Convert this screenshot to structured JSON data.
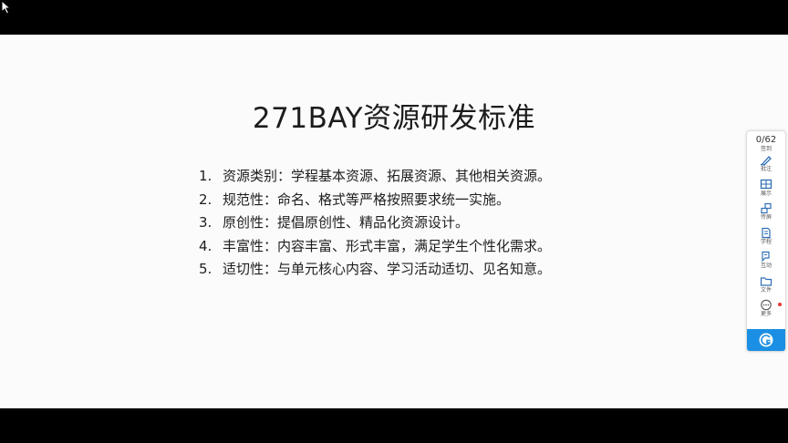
{
  "slide": {
    "title": "271BAY资源研发标准",
    "items": [
      {
        "num": "1.",
        "text": "资源类别：学程基本资源、拓展资源、其他相关资源。"
      },
      {
        "num": "2.",
        "text": "规范性：命名、格式等严格按照要求统一实施。"
      },
      {
        "num": "3.",
        "text": "原创性：提倡原创性、精品化资源设计。"
      },
      {
        "num": "4.",
        "text": "丰富性：内容丰富、形式丰富，满足学生个性化需求。"
      },
      {
        "num": "5.",
        "text": "适切性：与单元核心内容、学习活动适切、见名知意。"
      }
    ]
  },
  "toolbar": {
    "count": "0/62",
    "signin_label": "签到",
    "items": [
      {
        "label": "批注",
        "icon": "pen-icon"
      },
      {
        "label": "展示",
        "icon": "screen-icon"
      },
      {
        "label": "传屏",
        "icon": "cast-icon"
      },
      {
        "label": "学程",
        "icon": "document-icon"
      },
      {
        "label": "互动",
        "icon": "interact-icon"
      },
      {
        "label": "文件",
        "icon": "folder-icon"
      },
      {
        "label": "更多",
        "icon": "more-icon"
      }
    ],
    "accent_color": "#1a8fe3",
    "notification_color": "#e53935"
  }
}
